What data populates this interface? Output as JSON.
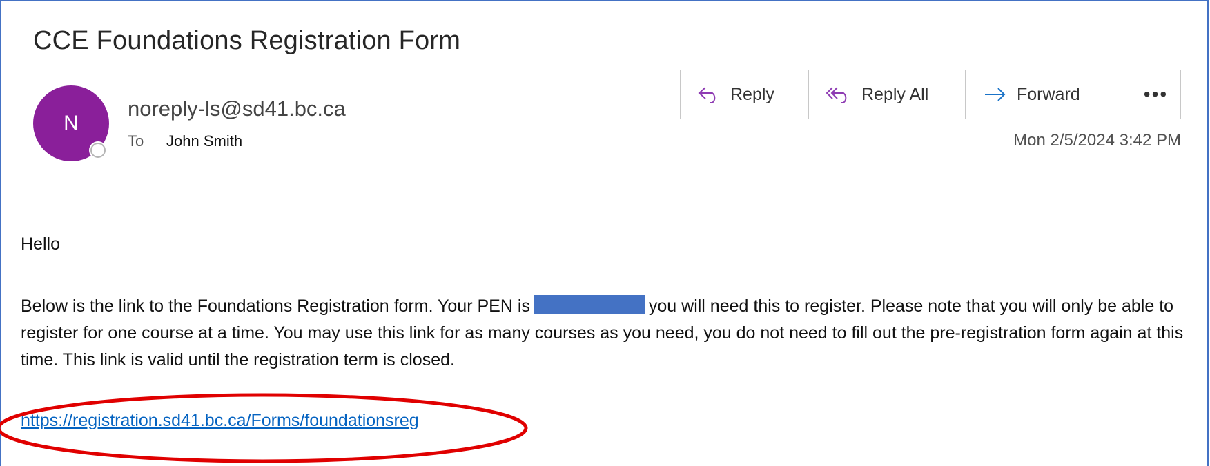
{
  "email": {
    "subject": "CCE Foundations Registration Form",
    "avatar_initial": "N",
    "avatar_color": "#8a1f9a",
    "sender": "noreply-ls@sd41.bc.ca",
    "to_label": "To",
    "to_name": "John Smith",
    "timestamp": "Mon 2/5/2024 3:42 PM"
  },
  "actions": {
    "reply": "Reply",
    "reply_all": "Reply All",
    "forward": "Forward",
    "more": "•••"
  },
  "body": {
    "greeting": "Hello",
    "paragraph_before_pen": "Below is the link to the Foundations Registration form. Your PEN is",
    "paragraph_after_pen": "you will need this to register. Please note that you will only be able to register for one course at a time. You may use this link for as many courses as you need, you do not need to fill out the pre-registration form again at this time. This link is valid until the registration term is closed.",
    "link": "https://registration.sd41.bc.ca/Forms/foundationsreg"
  },
  "colors": {
    "accent_blue": "#1a73c8",
    "link_blue": "#0563c1",
    "redaction": "#4472c4",
    "highlight_red": "#e00000"
  }
}
